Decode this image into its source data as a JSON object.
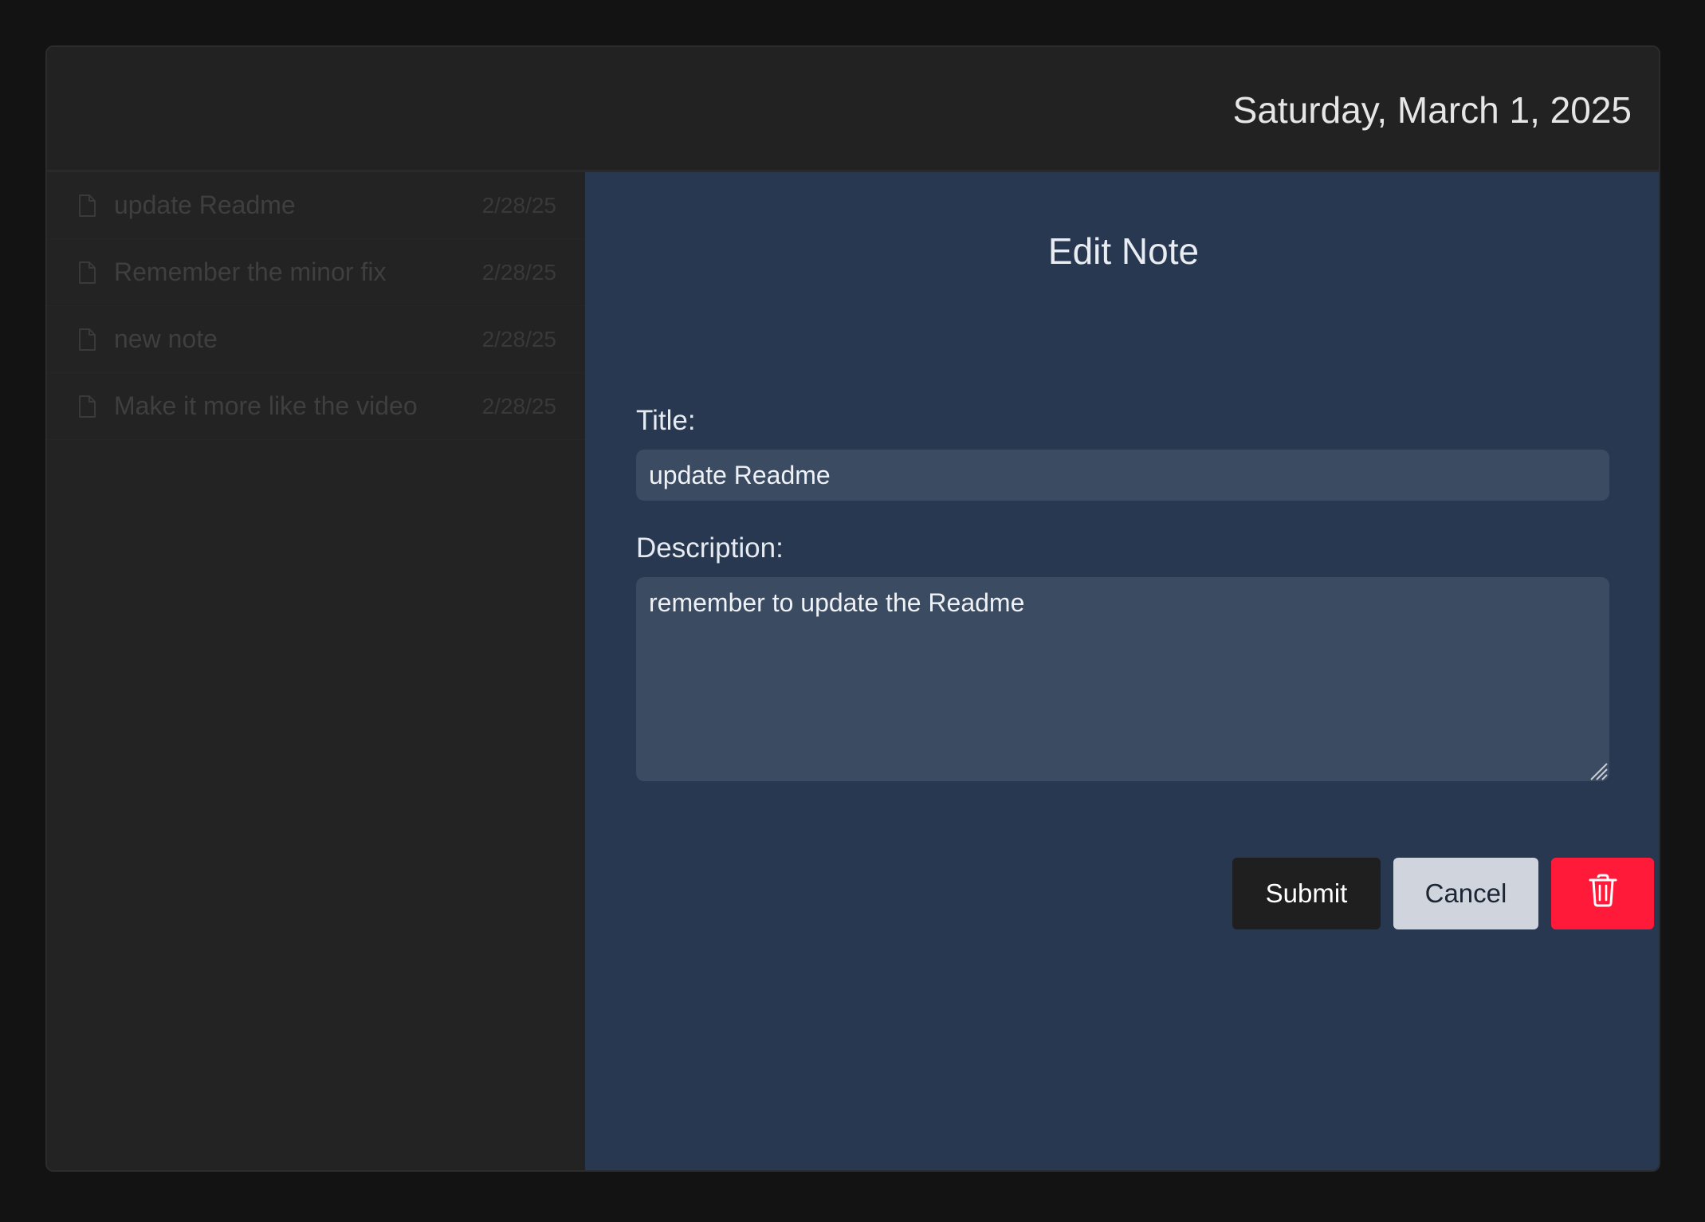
{
  "header": {
    "date": "Saturday, March 1, 2025"
  },
  "sidebar": {
    "notes": [
      {
        "title": "update Readme",
        "date": "2/28/25",
        "icon": "file-icon"
      },
      {
        "title": "Remember the minor fix",
        "date": "2/28/25",
        "icon": "file-icon"
      },
      {
        "title": "new note",
        "date": "2/28/25",
        "icon": "file-icon"
      },
      {
        "title": "Make it more like the video",
        "date": "2/28/25",
        "icon": "file-icon"
      }
    ]
  },
  "editor": {
    "heading": "Edit Note",
    "title_label": "Title:",
    "title_value": "update Readme",
    "description_label": "Description:",
    "description_value": "remember to update the Readme",
    "submit_label": "Submit",
    "cancel_label": "Cancel",
    "delete_icon": "trash-icon"
  },
  "colors": {
    "background": "#131313",
    "window": "#222222",
    "editor_panel": "#283850",
    "input_background": "#3b4b62",
    "submit_button": "#1f1f1f",
    "cancel_button": "#d0d4dc",
    "delete_button": "#ff1a3a"
  }
}
